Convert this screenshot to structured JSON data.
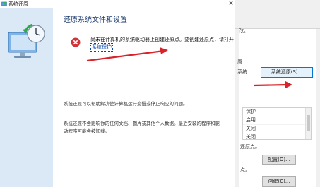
{
  "dialog": {
    "title": "系统还原",
    "close_glyph": "×",
    "heading": "还原系统文件和设置",
    "error_line1": "尚未在计算机的系统驱动器上创建还原点。要创建还原点，请打开",
    "error_link": "系统保护",
    "description_1": "系统还原可以帮助解决使计算机运行变慢或停止响应的问题。",
    "description_2_line1": "系统还原不会影响你的任何文档、图片或其他个人数据。最近安装的程序和驱",
    "description_2_line2": "动程序可能会被卸载。"
  },
  "background_window": {
    "partial_text_1": "改。",
    "partial_text_2": "原",
    "partial_text_3": "系统",
    "system_restore_button": "系统还原(S)...",
    "protection_header": "保护",
    "protection_rows": [
      "启用",
      "关闭",
      "关闭",
      "关闭"
    ],
    "configure_text": "还原点。",
    "configure_button": "配置(O)...",
    "create_text": "点。",
    "create_button": "创建(C)..."
  },
  "colors": {
    "annotation_arrow": "#d9232b",
    "sidebar": "#dbe8f6",
    "heading": "#1b3a6d",
    "link": "#0645ad",
    "error_icon": "#d13438"
  }
}
